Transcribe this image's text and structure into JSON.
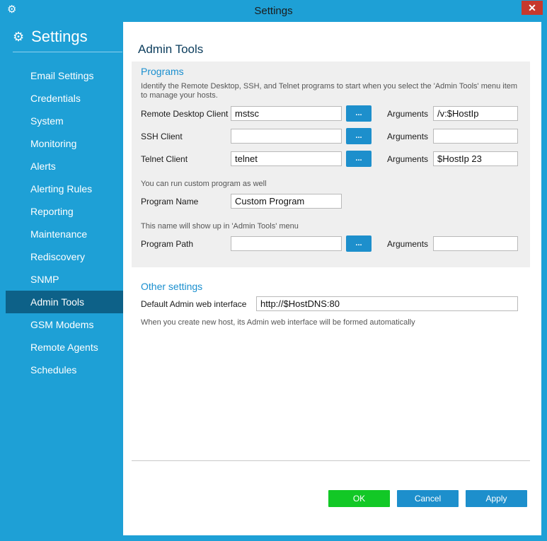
{
  "window": {
    "title": "Settings",
    "close_label": "✕"
  },
  "sidebar": {
    "title": "Settings",
    "items": [
      {
        "label": "Email Settings"
      },
      {
        "label": "Credentials"
      },
      {
        "label": "System"
      },
      {
        "label": "Monitoring"
      },
      {
        "label": "Alerts"
      },
      {
        "label": "Alerting Rules"
      },
      {
        "label": "Reporting"
      },
      {
        "label": "Maintenance"
      },
      {
        "label": "Rediscovery"
      },
      {
        "label": "SNMP"
      },
      {
        "label": "Admin Tools",
        "active": true
      },
      {
        "label": "GSM Modems"
      },
      {
        "label": "Remote Agents"
      },
      {
        "label": "Schedules"
      }
    ]
  },
  "main": {
    "title": "Admin Tools",
    "programs": {
      "title": "Programs",
      "description": "Identify the Remote Desktop, SSH, and Telnet programs to start when you select the 'Admin Tools' menu item to manage your hosts.",
      "browse_label": "...",
      "arguments_label": "Arguments",
      "rdp_label": "Remote Desktop Client",
      "rdp_value": "mstsc",
      "rdp_args": "/v:$HostIp",
      "ssh_label": "SSH Client",
      "ssh_value": "",
      "ssh_args": "",
      "telnet_label": "Telnet Client",
      "telnet_value": "telnet",
      "telnet_args": "$HostIp 23",
      "custom_hint": "You can run custom program as well",
      "program_name_label": "Program Name",
      "program_name_value": "Custom Program",
      "name_hint": "This name will show up in 'Admin Tools' menu",
      "program_path_label": "Program Path",
      "program_path_value": "",
      "program_path_args": ""
    },
    "other": {
      "title": "Other settings",
      "web_label": "Default Admin web interface",
      "web_value": "http://$HostDNS:80",
      "web_hint": "When you create new host, its Admin web interface will be formed automatically"
    }
  },
  "buttons": {
    "ok": "OK",
    "cancel": "Cancel",
    "apply": "Apply"
  }
}
